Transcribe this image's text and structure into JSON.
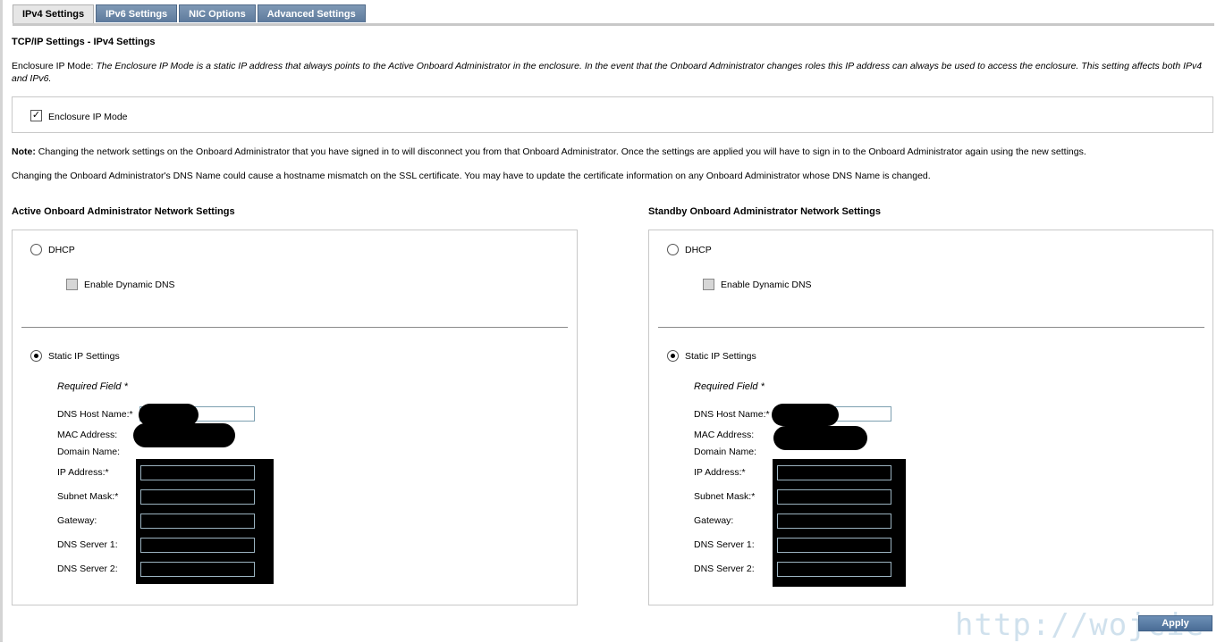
{
  "tabs": [
    {
      "label": "IPv4 Settings",
      "active": true
    },
    {
      "label": "IPv6 Settings",
      "active": false
    },
    {
      "label": "NIC Options",
      "active": false
    },
    {
      "label": "Advanced Settings",
      "active": false
    }
  ],
  "page_title": "TCP/IP Settings - IPv4 Settings",
  "enclosure": {
    "label_prefix": "Enclosure IP Mode: ",
    "description": "The Enclosure IP Mode is a static IP address that always points to the Active Onboard Administrator in the enclosure. In the event that the Onboard Administrator changes roles this IP address can always be used to access the enclosure. This setting affects both IPv4 and IPv6.",
    "checkbox_label": "Enclosure IP Mode",
    "checked": true
  },
  "note": {
    "label": "Note:",
    "text": " Changing the network settings on the Onboard Administrator that you have signed in to will disconnect you from that Onboard Administrator. Once the settings are applied you will have to sign in to the Onboard Administrator again using the new settings."
  },
  "dns_warning": "Changing the Onboard Administrator's DNS Name could cause a hostname mismatch on the SSL certificate. You may have to update the certificate information on any Onboard Administrator whose DNS Name is changed.",
  "active": {
    "title": "Active Onboard Administrator Network Settings",
    "dhcp_label": "DHCP",
    "dynamic_dns_label": "Enable Dynamic DNS",
    "static_label": "Static IP Settings",
    "required_note": "Required Field *",
    "labels": {
      "dns_host": "DNS Host Name:*",
      "mac": "MAC Address:",
      "domain": "Domain Name:",
      "ip": "IP Address:*",
      "subnet": "Subnet Mask:*",
      "gateway": "Gateway:",
      "dns1": "DNS Server 1:",
      "dns2": "DNS Server 2:"
    }
  },
  "standby": {
    "title": "Standby Onboard Administrator Network Settings",
    "dhcp_label": "DHCP",
    "dynamic_dns_label": "Enable Dynamic DNS",
    "static_label": "Static IP Settings",
    "required_note": "Required Field *",
    "labels": {
      "dns_host": "DNS Host Name:*",
      "mac": "MAC Address:",
      "domain": "Domain Name:",
      "ip": "IP Address:*",
      "subnet": "Subnet Mask:*",
      "gateway": "Gateway:",
      "dns1": "DNS Server 1:",
      "dns2": "DNS Server 2:"
    }
  },
  "apply_label": "Apply",
  "watermark": "http://wojcie",
  "colors": {
    "tab_active": "#e6e6e6",
    "tab_inactive": "#6a87a8",
    "apply": "#5b7ea6"
  }
}
